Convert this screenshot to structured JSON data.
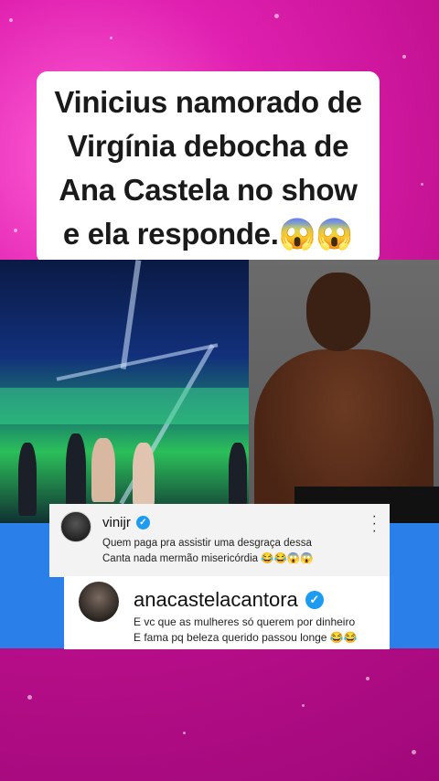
{
  "title": {
    "lines": [
      "Vinicius namorado de",
      "Virgínia debocha de",
      "Ana Castela no show",
      "e ela responde.😱😱"
    ]
  },
  "comment1": {
    "username": "vinijr",
    "verified_icon": "verified-check-icon",
    "menu_icon": "more-vertical-icon",
    "lines": [
      "Quem paga pra assistir uma desgraça dessa",
      "Canta nada mermão misericórdia 😂😂😱😱"
    ]
  },
  "comment2": {
    "username": "anacastelacantora",
    "verified_icon": "verified-check-icon",
    "lines": [
      "E vc que as mulheres só querem por dinheiro",
      "E fama pq beleza querido passou longe 😂😂"
    ]
  },
  "colors": {
    "background": "#d91aa8",
    "band": "#2b7fe8",
    "verified": "#1d9bf0"
  }
}
